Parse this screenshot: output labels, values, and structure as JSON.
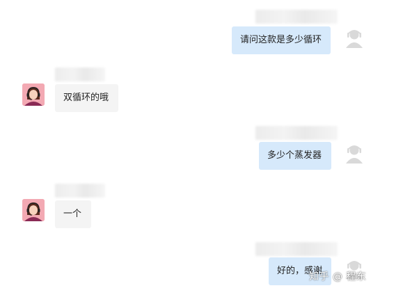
{
  "conversation": {
    "messages": [
      {
        "side": "out",
        "text": "请问这款是多少循环"
      },
      {
        "side": "in",
        "text": "双循环的哦"
      },
      {
        "side": "out",
        "text": "多少个蒸发器"
      },
      {
        "side": "in",
        "text": "一个"
      },
      {
        "side": "out",
        "text": "好的，感谢"
      }
    ]
  },
  "watermark": "知乎 @ 程东",
  "icons": {
    "agent_avatar": "agent-headset-avatar-icon",
    "user_avatar": "user-silhouette-avatar-icon"
  },
  "colors": {
    "outgoing_bubble": "#d6e9fb",
    "incoming_bubble": "#f4f4f4",
    "agent_avatar_bg": "#f3a9b3",
    "user_avatar": "#d9d9d9"
  }
}
